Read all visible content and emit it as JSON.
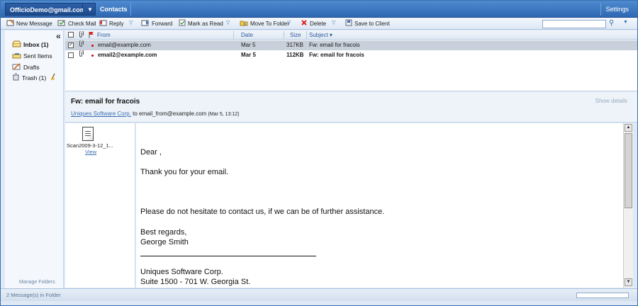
{
  "topbar": {
    "account": "OfficioDemo@gmail.com",
    "contacts": "Contacts",
    "settings": "Settings"
  },
  "toolbar": {
    "new_message": "New Message",
    "check_mail": "Check Mail",
    "reply": "Reply",
    "forward": "Forward",
    "mark_as_read": "Mark as Read",
    "move_to_folder": "Move To Folder",
    "delete": "Delete",
    "save_to_client": "Save to Client",
    "search_placeholder": ""
  },
  "sidebar": {
    "folders": [
      {
        "label": "Inbox (1)",
        "icon": "inbox-icon",
        "bold": true
      },
      {
        "label": "Sent Items",
        "icon": "sent-items-icon",
        "bold": false
      },
      {
        "label": "Drafts",
        "icon": "drafts-icon",
        "bold": false
      },
      {
        "label": "Trash (1)",
        "icon": "trash-icon",
        "bold": false
      }
    ],
    "manage": "Manage Folders"
  },
  "list": {
    "headers": {
      "from": "From",
      "date": "Date",
      "size": "Size",
      "subject": "Subject"
    },
    "rows": [
      {
        "from": "email@example.com",
        "date": "Mar 5",
        "size": "317KB",
        "subject": "Fw: email for fracois",
        "checked": true,
        "unread": false
      },
      {
        "from": "email2@example.com",
        "date": "Mar 5",
        "size": "112KB",
        "subject": "Fw: email for fracois",
        "checked": false,
        "unread": true
      }
    ]
  },
  "preview": {
    "subject": "Fw: email for fracois",
    "show_details": "Show details",
    "from_name": "Uniques Software Corp.",
    "to_text": " to email_from@example.com ",
    "date": "(Mar 5, 13:12)",
    "attachment": {
      "name": "Scan2009-3-12_1...",
      "view": "View"
    },
    "body": {
      "greeting": "Dear ,",
      "line1": "Thank you for your email.",
      "line2": "Please do not hesitate to contact us, if we can be of further assistance.",
      "closing": "Best regards,",
      "signer": "George Smith",
      "company": "Uniques Software Corp.",
      "address": "Suite 1500 - 701 W. Georgia St."
    }
  },
  "status": {
    "text": "2 Message(s) in Folder"
  },
  "colors": {
    "accent": "#2f68b2",
    "header_bg": "#4f8bd0",
    "selected_row": "#c8d0db"
  }
}
